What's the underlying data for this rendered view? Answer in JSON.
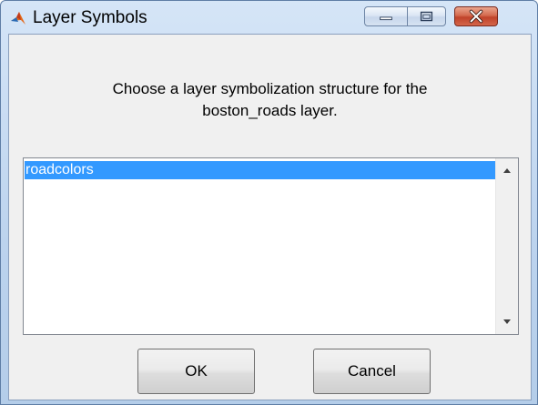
{
  "window": {
    "title": "Layer Symbols"
  },
  "titlebar": {
    "app_icon": "matlab-logo-icon",
    "controls": [
      "minimize-icon",
      "maximize-icon",
      "close-icon"
    ],
    "close_color": "#c7472b"
  },
  "dialog": {
    "prompt_line1": "Choose a layer symbolization structure for the",
    "prompt_line2": "boston_roads layer."
  },
  "listbox": {
    "items": [
      {
        "label": "roadcolors",
        "selected": true
      }
    ],
    "selection_color": "#3399ff",
    "scroll_icons": [
      "scroll-up-icon",
      "scroll-down-icon"
    ]
  },
  "buttons": {
    "ok_label": "OK",
    "cancel_label": "Cancel"
  }
}
